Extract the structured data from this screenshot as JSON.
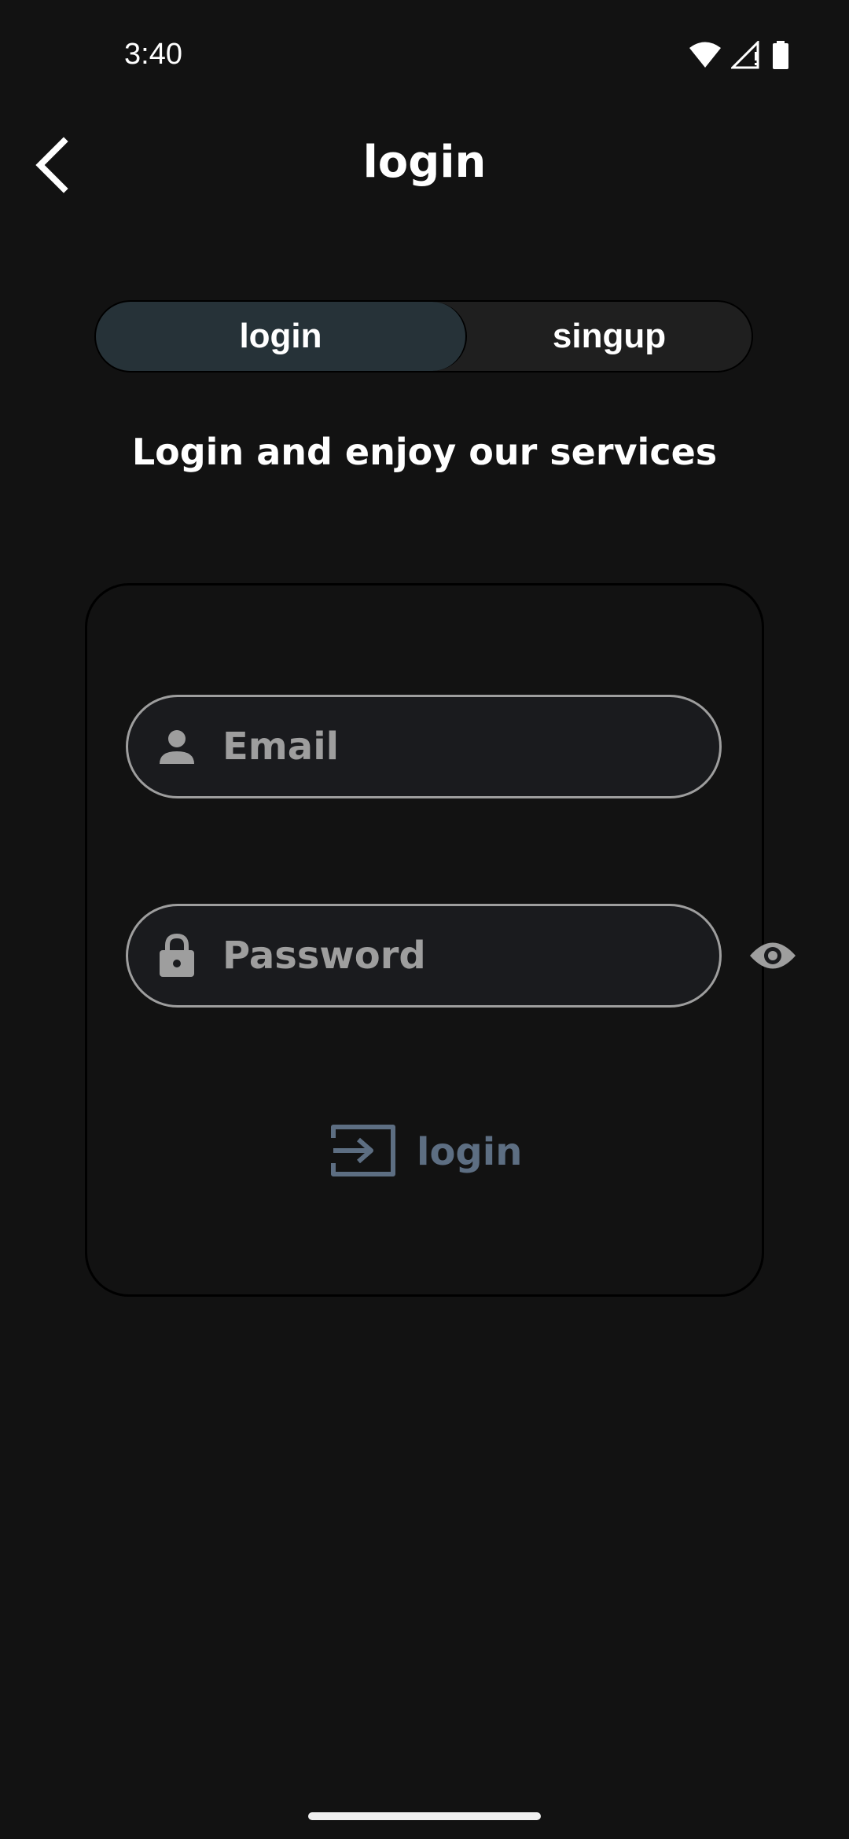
{
  "status_bar": {
    "time": "3:40",
    "icons": [
      "wifi-icon",
      "cell-signal-icon",
      "battery-icon"
    ]
  },
  "app_bar": {
    "back_icon": "chevron-left-icon",
    "title": "login"
  },
  "tabs": {
    "login_label": "login",
    "signup_label": "singup",
    "selected": "login"
  },
  "subtitle": "Login and enjoy our services",
  "form": {
    "email": {
      "icon": "person-icon",
      "placeholder": "Email",
      "value": ""
    },
    "password": {
      "icon": "lock-icon",
      "placeholder": "Password",
      "value": "",
      "toggle_icon": "eye-icon"
    },
    "submit": {
      "icon": "login-arrow-icon",
      "label": "login"
    }
  },
  "colors": {
    "background": "#121212",
    "selected_tab": "#263238",
    "unselected_tab": "#1f1f1f",
    "field_border": "#9e9e9e",
    "placeholder": "#9e9e9e",
    "submit": "#5d6e82",
    "text": "#ffffff"
  }
}
